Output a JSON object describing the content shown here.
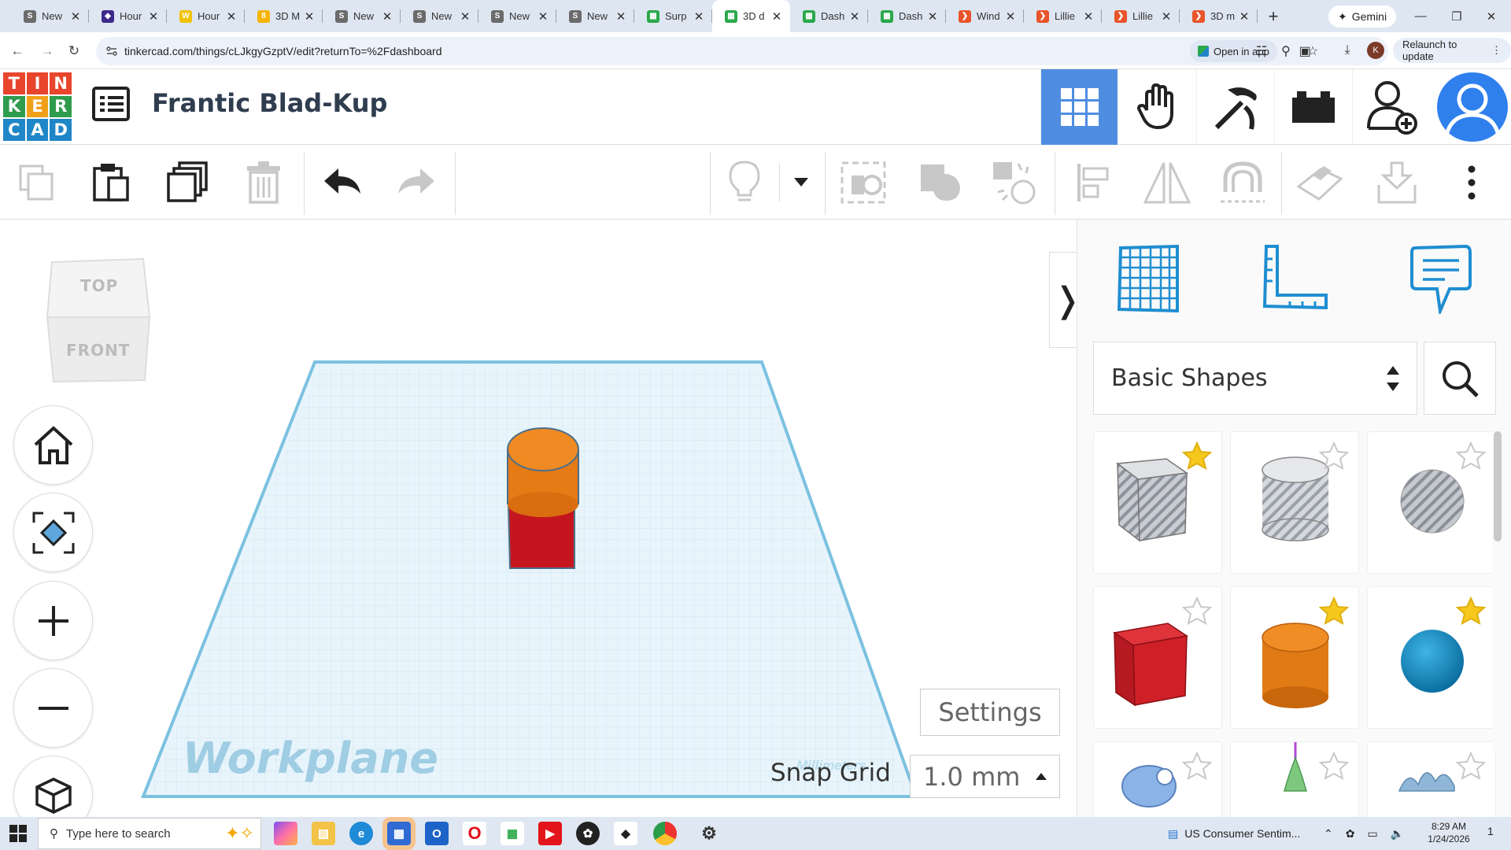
{
  "browser": {
    "tabs": [
      {
        "title": "New",
        "favicon_color": "#6b6b6b",
        "favicon_text": "S"
      },
      {
        "title": "Hour",
        "favicon_color": "#3b2a8a",
        "favicon_text": "◆"
      },
      {
        "title": "Hour",
        "favicon_color": "#f2c200",
        "favicon_text": "W"
      },
      {
        "title": "3D M",
        "favicon_color": "#f7b500",
        "favicon_text": "8"
      },
      {
        "title": "New",
        "favicon_color": "#6b6b6b",
        "favicon_text": "S"
      },
      {
        "title": "New",
        "favicon_color": "#6b6b6b",
        "favicon_text": "S"
      },
      {
        "title": "New",
        "favicon_color": "#6b6b6b",
        "favicon_text": "S"
      },
      {
        "title": "New",
        "favicon_color": "#6b6b6b",
        "favicon_text": "S"
      },
      {
        "title": "Surp",
        "favicon_color": "#2aa84a",
        "favicon_text": "▦"
      },
      {
        "title": "3D d",
        "favicon_color": "#2aa84a",
        "favicon_text": "▦",
        "active": true
      },
      {
        "title": "Dash",
        "favicon_color": "#2aa84a",
        "favicon_text": "▦"
      },
      {
        "title": "Dash",
        "favicon_color": "#2aa84a",
        "favicon_text": "▦"
      },
      {
        "title": "Wind",
        "favicon_color": "#e8552a",
        "favicon_text": "❯"
      },
      {
        "title": "Lillie",
        "favicon_color": "#e8552a",
        "favicon_text": "❯"
      },
      {
        "title": "Lillie",
        "favicon_color": "#e8552a",
        "favicon_text": "❯"
      },
      {
        "title": "3D m",
        "favicon_color": "#e8552a",
        "favicon_text": "❯"
      }
    ],
    "gemini_label": "Gemini",
    "url": "tinkercad.com/things/cLJkgyGzptV/edit?returnTo=%2Fdashboard",
    "open_in_app_label": "Open in app",
    "profile_initial": "K",
    "relaunch_label": "Relaunch to update"
  },
  "tinkercad": {
    "logo_letters": [
      "T",
      "I",
      "N",
      "K",
      "E",
      "R",
      "C",
      "A",
      "D"
    ],
    "logo_colors": [
      "#e8452c",
      "#e8452c",
      "#e8452c",
      "#2f9c4d",
      "#f0a018",
      "#2f9c4d",
      "#1f86c7",
      "#1f86c7",
      "#1f86c7"
    ],
    "design_title": "Frantic Blad-Kup",
    "accent": "#4f8de1"
  },
  "viewcube": {
    "top": "TOP",
    "front": "FRONT"
  },
  "workspace": {
    "workplane_label": "Workplane",
    "units_label": "Millimeters",
    "settings_label": "Settings",
    "snap_label": "Snap Grid",
    "snap_value": "1.0 mm",
    "collapse_glyph": "❭"
  },
  "library": {
    "selected": "Basic Shapes",
    "shapes": [
      {
        "name": "box-hole",
        "starred": true
      },
      {
        "name": "cylinder-hole",
        "starred": false
      },
      {
        "name": "sphere-hole",
        "starred": false
      },
      {
        "name": "box",
        "starred": false
      },
      {
        "name": "cylinder",
        "starred": true
      },
      {
        "name": "sphere",
        "starred": true
      },
      {
        "name": "scribble",
        "starred": false
      },
      {
        "name": "cone",
        "starred": false
      },
      {
        "name": "text",
        "starred": false
      }
    ]
  },
  "taskbar": {
    "search_placeholder": "Type here to search",
    "news": "US Consumer Sentim...",
    "time": "8:29 AM",
    "date": "1/24/2026",
    "notif_count": "1"
  }
}
